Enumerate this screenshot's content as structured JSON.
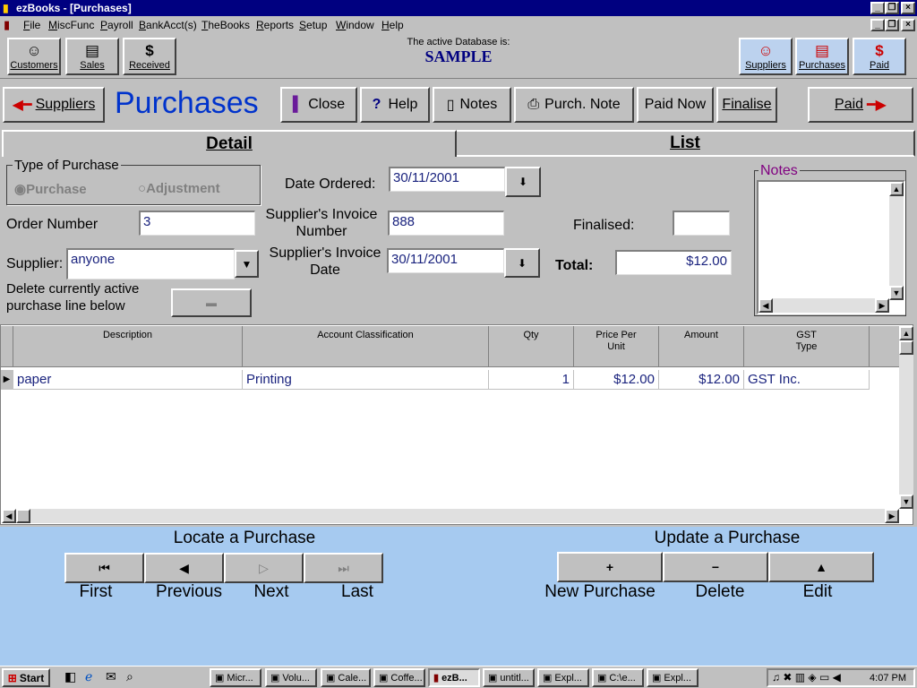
{
  "window": {
    "title": "ezBooks - [Purchases]"
  },
  "menu": [
    "File",
    "MiscFunc",
    "Payroll",
    "BankAcct(s)",
    "TheBooks",
    "Reports",
    "Setup",
    "Window",
    "Help"
  ],
  "toolbar": {
    "left": [
      {
        "label": "Customers",
        "icon": "☺"
      },
      {
        "label": "Sales",
        "icon": "▤"
      },
      {
        "label": "Received",
        "icon": "$"
      }
    ],
    "db_caption": "The active Database is:",
    "db_name": "SAMPLE",
    "right": [
      {
        "label": "Suppliers",
        "icon": "☺"
      },
      {
        "label": "Purchases",
        "icon": "▤"
      },
      {
        "label": "Paid",
        "icon": "$"
      }
    ]
  },
  "nav": {
    "back_label": "Suppliers",
    "page_title": "Purchases",
    "close": "Close",
    "help": "Help",
    "notes": "Notes",
    "purch_note": "Purch. Note",
    "paid_now": "Paid Now",
    "finalise": "Finalise",
    "forward_label": "Paid"
  },
  "tabs": {
    "detail": "Detail",
    "list": "List"
  },
  "form": {
    "type_group": "Type of Purchase",
    "type_purchase": "Purchase",
    "type_adjustment": "Adjustment",
    "date_ordered_label": "Date Ordered:",
    "date_ordered": "30/11/2001",
    "order_number_label": "Order Number",
    "order_number": "3",
    "supplier_invoice_number_label": "Supplier's Invoice Number",
    "supplier_invoice_number": "888",
    "finalised_label": "Finalised:",
    "finalised": "",
    "supplier_label": "Supplier:",
    "supplier": "anyone",
    "supplier_invoice_date_label": "Supplier's Invoice Date",
    "supplier_invoice_date": "30/11/2001",
    "total_label": "Total:",
    "total": "$12.00",
    "delete_line_label": "Delete currently active purchase line below",
    "notes_label": "Notes"
  },
  "grid": {
    "columns": [
      "Description",
      "Account Classification",
      "Qty",
      "Price Per Unit",
      "Amount",
      "GST Type"
    ],
    "rows": [
      {
        "description": "paper",
        "account": "Printing",
        "qty": "1",
        "price": "$12.00",
        "amount": "$12.00",
        "gst": "GST Inc."
      }
    ]
  },
  "locate": {
    "title": "Locate a Purchase",
    "first": "First",
    "previous": "Previous",
    "next": "Next",
    "last": "Last"
  },
  "update": {
    "title": "Update a Purchase",
    "new": "New Purchase",
    "delete": "Delete",
    "edit": "Edit"
  },
  "taskbar": {
    "start": "Start",
    "tasks": [
      "Micr...",
      "Volu...",
      "Cale...",
      "Coffe...",
      "ezB...",
      "untitl...",
      "Expl...",
      "C:\\e...",
      "Expl..."
    ],
    "clock": "4:07 PM"
  },
  "colors": {
    "title_bar": "#000080",
    "page_title": "#0033cc",
    "bottom_panel": "#a6caf0",
    "toolbar_highlight": "#bcd2ee"
  }
}
